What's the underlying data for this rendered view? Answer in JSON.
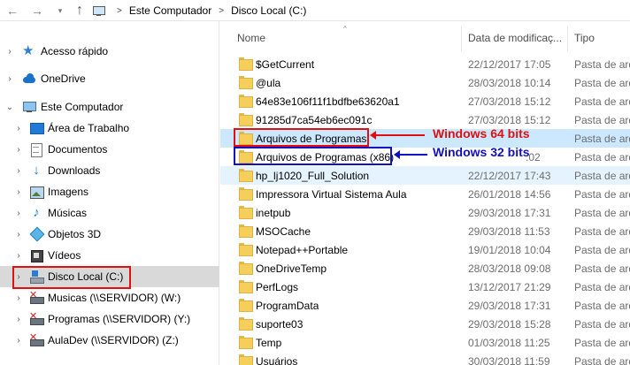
{
  "address": {
    "crumbs": [
      "Este Computador",
      "Disco Local (C:)"
    ],
    "crumb_separator": ">"
  },
  "tree": {
    "items": [
      {
        "label": "Acesso rápido",
        "icon": "star-icon"
      },
      {
        "label": "OneDrive",
        "icon": "cloud-icon"
      },
      {
        "label": "Este Computador",
        "icon": "computer-icon"
      },
      {
        "label": "Área de Trabalho",
        "icon": "desktop-icon"
      },
      {
        "label": "Documentos",
        "icon": "documents-icon"
      },
      {
        "label": "Downloads",
        "icon": "downloads-icon"
      },
      {
        "label": "Imagens",
        "icon": "pictures-icon"
      },
      {
        "label": "Músicas",
        "icon": "music-icon"
      },
      {
        "label": "Objetos 3D",
        "icon": "3d-objects-icon"
      },
      {
        "label": "Vídeos",
        "icon": "videos-icon"
      },
      {
        "label": "Disco Local (C:)",
        "icon": "local-disk-icon"
      },
      {
        "label": "Musicas (\\\\SERVIDOR) (W:)",
        "icon": "network-drive-icon"
      },
      {
        "label": "Programas (\\\\SERVIDOR) (Y:)",
        "icon": "network-drive-icon"
      },
      {
        "label": "AulaDev (\\\\SERVIDOR) (Z:)",
        "icon": "network-drive-icon"
      }
    ],
    "selected_index": 10
  },
  "columns": {
    "name": "Nome",
    "date": "Data de modificaç...",
    "type": "Tipo"
  },
  "rows": [
    {
      "name": "$GetCurrent",
      "date": "22/12/2017 17:05",
      "type": "Pasta de arq"
    },
    {
      "name": "@ula",
      "date": "28/03/2018 10:14",
      "type": "Pasta de arq"
    },
    {
      "name": "64e83e106f11f1bdfbe63620a1",
      "date": "27/03/2018 15:12",
      "type": "Pasta de arq"
    },
    {
      "name": "91285d7ca54eb6ec091c",
      "date": "27/03/2018 15:12",
      "type": "Pasta de arq"
    },
    {
      "name": "Arquivos de Programas",
      "date": "",
      "type": "Pasta de arq"
    },
    {
      "name": "Arquivos de Programas (x86)",
      "date": ":02",
      "type": "Pasta de arq"
    },
    {
      "name": "hp_lj1020_Full_Solution",
      "date": "22/12/2017 17:43",
      "type": "Pasta de arq"
    },
    {
      "name": "Impressora Virtual Sistema Aula",
      "date": "26/01/2018 14:56",
      "type": "Pasta de arq"
    },
    {
      "name": "inetpub",
      "date": "29/03/2018 17:31",
      "type": "Pasta de arq"
    },
    {
      "name": "MSOCache",
      "date": "29/03/2018 11:53",
      "type": "Pasta de arq"
    },
    {
      "name": "Notepad++Portable",
      "date": "19/01/2018 10:04",
      "type": "Pasta de arq"
    },
    {
      "name": "OneDriveTemp",
      "date": "28/03/2018 09:08",
      "type": "Pasta de arq"
    },
    {
      "name": "PerfLogs",
      "date": "13/12/2017 21:29",
      "type": "Pasta de arq"
    },
    {
      "name": "ProgramData",
      "date": "29/03/2018 17:31",
      "type": "Pasta de arq"
    },
    {
      "name": "suporte03",
      "date": "29/03/2018 15:28",
      "type": "Pasta de arq"
    },
    {
      "name": "Temp",
      "date": "01/03/2018 11:25",
      "type": "Pasta de arq"
    },
    {
      "name": "Usuários",
      "date": "30/03/2018 11:59",
      "type": "Pasta de arq"
    }
  ],
  "annotations": {
    "label_64": "Windows 64 bits",
    "label_32": "Windows 32 bits",
    "color_red": "#e01010",
    "color_blue": "#1010c0"
  },
  "colors": {
    "selected_row": "#cce8ff",
    "hover_row": "#e5f3ff",
    "folder": "#f5cf5a"
  }
}
